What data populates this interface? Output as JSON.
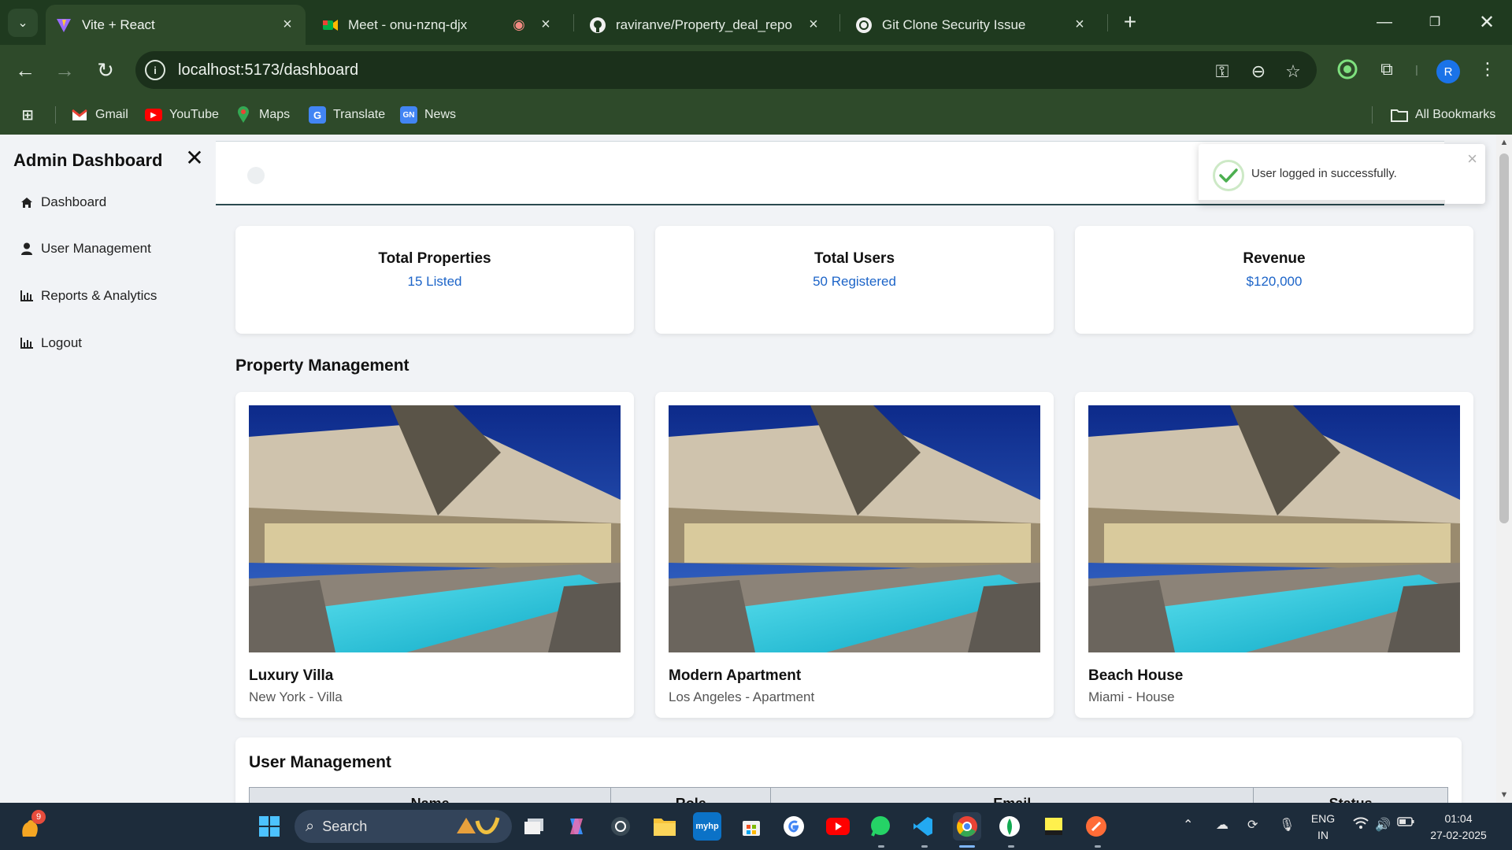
{
  "browser": {
    "tabs": [
      {
        "title": "Vite + React",
        "active": true,
        "icon": "vite-icon"
      },
      {
        "title": "Meet - onu-nznq-djx",
        "active": false,
        "icon": "meet-icon"
      },
      {
        "title": "raviranve/Property_deal_repo",
        "active": false,
        "icon": "github-icon"
      },
      {
        "title": "Git Clone Security Issue",
        "active": false,
        "icon": "chatgpt-icon"
      }
    ],
    "url": "localhost:5173/dashboard",
    "profile_initial": "R",
    "bookmarks": [
      {
        "label": "Gmail",
        "icon": "gmail-icon"
      },
      {
        "label": "YouTube",
        "icon": "youtube-icon"
      },
      {
        "label": "Maps",
        "icon": "maps-icon"
      },
      {
        "label": "Translate",
        "icon": "translate-icon"
      },
      {
        "label": "News",
        "icon": "news-icon"
      }
    ],
    "all_bookmarks": "All Bookmarks"
  },
  "sidebar": {
    "title": "Admin Dashboard",
    "items": [
      {
        "label": "Dashboard",
        "icon": "home-icon"
      },
      {
        "label": "User Management",
        "icon": "user-icon"
      },
      {
        "label": "Reports & Analytics",
        "icon": "bar-chart-icon"
      },
      {
        "label": "Logout",
        "icon": "bar-chart-icon"
      }
    ]
  },
  "stats": [
    {
      "label": "Total Properties",
      "value": "15 Listed"
    },
    {
      "label": "Total Users",
      "value": "50 Registered"
    },
    {
      "label": "Revenue",
      "value": "$120,000"
    }
  ],
  "property_section": {
    "title": "Property Management",
    "properties": [
      {
        "name": "Luxury Villa",
        "meta": "New York - Villa"
      },
      {
        "name": "Modern Apartment",
        "meta": "Los Angeles - Apartment"
      },
      {
        "name": "Beach House",
        "meta": "Miami - House"
      }
    ]
  },
  "user_section": {
    "title": "User Management",
    "columns": [
      "Name",
      "Role",
      "Email",
      "Status"
    ]
  },
  "toast": {
    "message": "User logged in successfully.",
    "progress": 0.86
  },
  "taskbar": {
    "search_placeholder": "Search",
    "notification_count": "9",
    "language": "ENG",
    "region": "IN",
    "time": "01:04",
    "date": "27-02-2025"
  },
  "colors": {
    "accent_link": "#1c64c8",
    "tabbar": "#1f3a1f",
    "toolbar": "#2e4a2a",
    "toast_success": "#4caf50"
  }
}
